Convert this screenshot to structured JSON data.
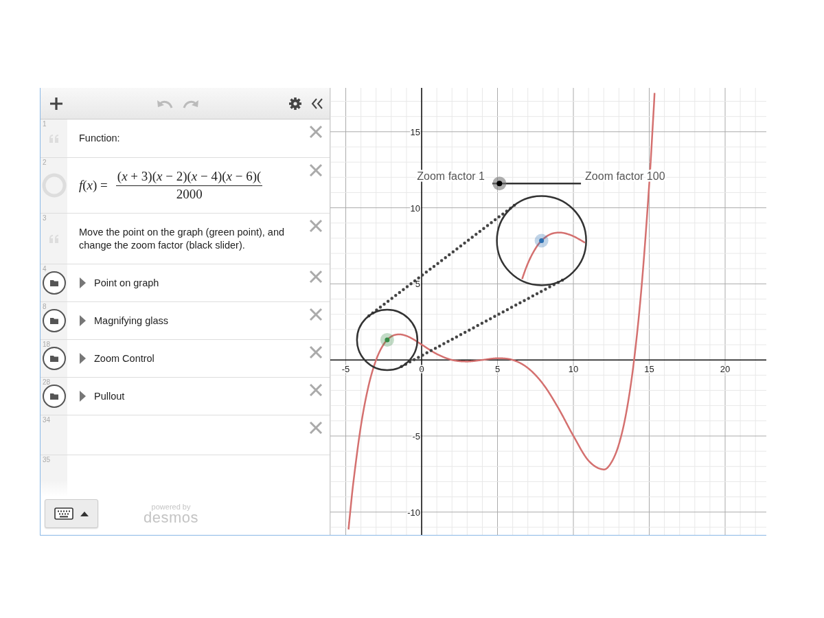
{
  "toolbar": [
    {
      "kind": "add",
      "disabled": false
    },
    {
      "kind": "undo",
      "disabled": true
    },
    {
      "kind": "redo",
      "disabled": true
    },
    {
      "kind": "settings",
      "disabled": false
    },
    {
      "kind": "collapse",
      "disabled": false
    }
  ],
  "expressions": [
    {
      "number": "1",
      "kind": "note",
      "text": "Function:"
    },
    {
      "number": "2",
      "kind": "math",
      "lhs": "*f*(*x*) =",
      "numerator": "(*x* + 3)(*x* − 2)(*x* − 4)(*x* − 6)(",
      "denominator": "2000",
      "hidden": true
    },
    {
      "number": "3",
      "kind": "note",
      "text": "Move the point on the graph (green point), and change the zoom factor (black slider)."
    },
    {
      "number": "4",
      "kind": "folder",
      "text": "Point on graph",
      "expanded": false
    },
    {
      "number": "8",
      "kind": "folder",
      "text": "Magnifying glass",
      "expanded": false
    },
    {
      "number": "18",
      "kind": "folder",
      "text": "Zoom Control",
      "expanded": false
    },
    {
      "number": "28",
      "kind": "folder",
      "text": "Pullout",
      "expanded": false
    },
    {
      "number": "34",
      "kind": "empty"
    },
    {
      "number": "35",
      "kind": "new"
    }
  ],
  "branding": {
    "powered_by": "powered by",
    "name": "desmos"
  },
  "graph": {
    "chart_data": {
      "type": "line",
      "x": [
        -4.82,
        -4.75,
        -4.5,
        -4,
        -3.5,
        -3,
        -2.5,
        -2,
        -1.5,
        -1,
        -0.5,
        0,
        1,
        2,
        3,
        4,
        5,
        6,
        7,
        8,
        9,
        10,
        11,
        12,
        12.5,
        13,
        13.5,
        14,
        14.5,
        15,
        15.3,
        15.35
      ],
      "series": [
        {
          "color": "#d4706f",
          "values": [
            -11.15,
            -10.42,
            -8.05,
            -4.32,
            -1.71,
            0,
            1.03,
            1.54,
            1.68,
            1.58,
            1.33,
            1.01,
            0.39,
            0,
            -0.1,
            0,
            0.11,
            0,
            -0.53,
            -1.58,
            -3.15,
            -4.99,
            -6.62,
            -7.2,
            -6.74,
            -5.54,
            -3.38,
            0,
            4.88,
            11.58,
            16.6,
            17.55
          ]
        }
      ],
      "grid": true,
      "xlim": [
        -6.02,
        22.76
      ],
      "ylim": [
        -11.5,
        17.88
      ],
      "xticks": [
        -5,
        0,
        5,
        10,
        15,
        20
      ],
      "yticks": [
        -10,
        -5,
        5,
        10,
        15
      ]
    },
    "slider": {
      "min_label": "Zoom factor 1",
      "max_label": "Zoom factor 100",
      "level": 0.08
    }
  }
}
